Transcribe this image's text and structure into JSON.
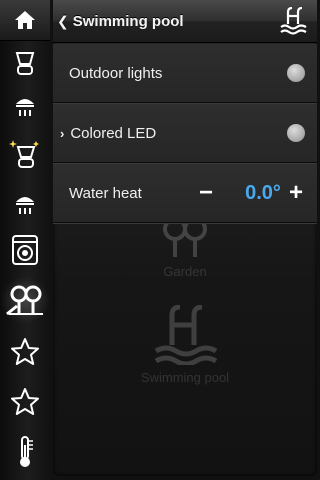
{
  "header": {
    "title": "Swimming pool"
  },
  "rows": [
    {
      "label": "Outdoor lights",
      "has_submenu": false
    },
    {
      "label": "Colored LED",
      "has_submenu": true
    }
  ],
  "water_heat": {
    "label": "Water heat",
    "minus": "−",
    "value": "0.0°",
    "plus": "+"
  },
  "background_items": [
    {
      "label": "Garden"
    },
    {
      "label": "Swimming pool"
    }
  ],
  "sidebar": {
    "items": [
      {
        "icon": "home-icon"
      },
      {
        "icon": "ceiling-lamp-icon"
      },
      {
        "icon": "spot-light-icon"
      },
      {
        "icon": "sparkle-lamp-icon"
      },
      {
        "icon": "spot-light-icon"
      },
      {
        "icon": "washing-machine-icon"
      },
      {
        "icon": "garden-icon"
      },
      {
        "icon": "star-icon"
      },
      {
        "icon": "star-icon"
      },
      {
        "icon": "thermometer-icon"
      }
    ]
  },
  "colors": {
    "accent": "#4aa9ee",
    "panel": "#262626",
    "toggle_off": "#b5b5b5"
  }
}
